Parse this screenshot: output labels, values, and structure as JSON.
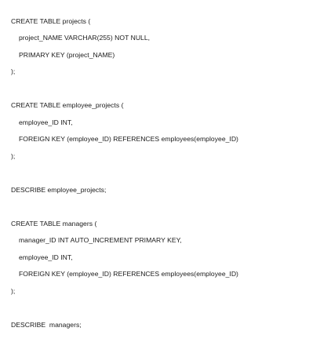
{
  "document": {
    "lines": [
      "CREATE TABLE projects (",
      "project_NAME VARCHAR(255) NOT NULL,",
      "PRIMARY KEY (project_NAME)",
      ");",
      "CREATE TABLE employee_projects (",
      "employee_ID INT,",
      "FOREIGN KEY (employee_ID) REFERENCES employees(employee_ID)",
      ");",
      "DESCRIBE employee_projects;",
      "CREATE TABLE managers (",
      "manager_ID INT AUTO_INCREMENT PRIMARY KEY,",
      "employee_ID INT,",
      "FOREIGN KEY (employee_ID) REFERENCES employees(employee_ID)",
      ");",
      "DESCRIBE  managers;"
    ]
  }
}
